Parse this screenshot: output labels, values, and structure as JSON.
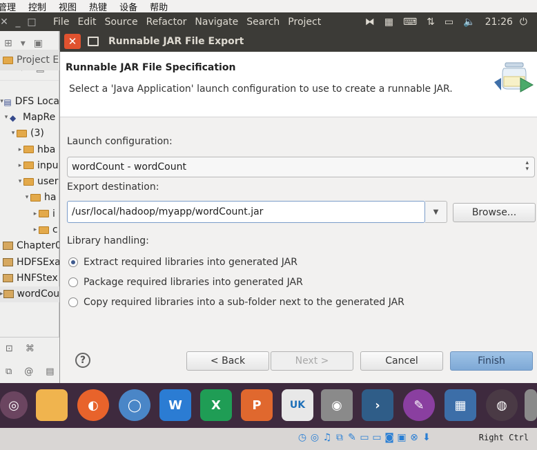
{
  "vbox_menu": [
    "管理",
    "控制",
    "视图",
    "热键",
    "设备",
    "帮助"
  ],
  "top_panel": {
    "menus": [
      "File",
      "Edit",
      "Source",
      "Refactor",
      "Navigate",
      "Search",
      "Project"
    ],
    "clock": "21:26"
  },
  "eclipse": {
    "project_tab": "Project Exp",
    "tree": [
      "DFS Loca",
      "MapRe",
      "(3)",
      "hba",
      "inpu",
      "user",
      "ha",
      "i",
      "c",
      "Chapter0",
      "HDFSExa",
      "HNFStex",
      "wordCou"
    ]
  },
  "dialog": {
    "title": "Runnable JAR File Export",
    "banner_title": "Runnable JAR File Specification",
    "banner_message": "Select a 'Java Application' launch configuration to use to create a runnable JAR.",
    "launch_label": "Launch configuration:",
    "launch_value": "wordCount - wordCount",
    "dest_label": "Export destination:",
    "dest_value": "/usr/local/hadoop/myapp/wordCount.jar",
    "browse_label": "Browse...",
    "library_label": "Library handling:",
    "library_options": [
      "Extract required libraries into generated JAR",
      "Package required libraries into generated JAR",
      "Copy required libraries into a sub-folder next to the generated JAR"
    ],
    "selected_option": 0,
    "buttons": {
      "back": "< Back",
      "next": "Next >",
      "cancel": "Cancel",
      "finish": "Finish"
    }
  },
  "dock": {
    "icons": [
      "ubuntu-icon",
      "files-icon",
      "firefox-icon",
      "chromium-icon",
      "word-icon",
      "excel-icon",
      "powerpoint-icon",
      "store-icon",
      "eclipse-icon",
      "terminal-icon",
      "editor-icon",
      "apps-icon",
      "disk-icon",
      "trash-icon"
    ]
  },
  "status_bar": {
    "host_key": "Right Ctrl"
  },
  "colors": {
    "titlebar": "#3c3b37",
    "close": "#e0522f",
    "dock": "#3e2a3e",
    "finish": "#8cb5de"
  }
}
